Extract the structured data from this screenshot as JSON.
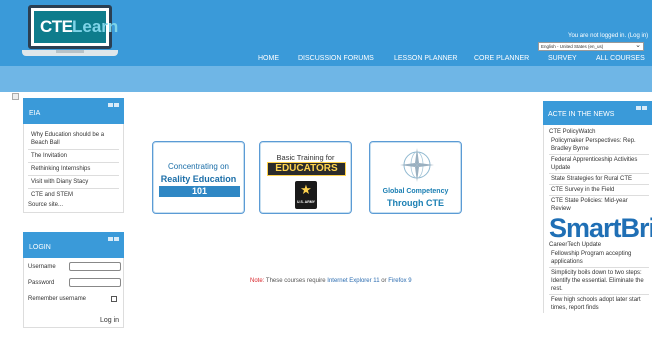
{
  "header": {
    "logo_text_a": "CTE",
    "logo_text_b": "Learn",
    "login_status": "You are not logged in. (Log in)",
    "language": "English - United States (en_us)"
  },
  "nav": {
    "items": [
      "HOME",
      "DISCUSSION FORUMS",
      "LESSON PLANNER",
      "CORE PLANNER",
      "SURVEY",
      "ALL COURSES"
    ]
  },
  "eia_block": {
    "title": "EIA",
    "links": [
      "Why Education should be a Beach Ball",
      "The Invitation",
      "Rethinking Internships",
      "Visit with Diany Stacy",
      "CTE and STEM"
    ],
    "more": "Source site..."
  },
  "login_block": {
    "title": "LOGIN",
    "username_label": "Username",
    "password_label": "Password",
    "remember_label": "Remember username",
    "button_label": "Log in"
  },
  "courses": {
    "c1": {
      "line1": "Concentrating on",
      "line2": "Reality Education",
      "line3": "101"
    },
    "c2": {
      "line1": "Basic Training for",
      "line2": "EDUCATORS",
      "army": "U.S. ARMY"
    },
    "c3": {
      "line1": "Global Competency",
      "line2": "Through CTE"
    }
  },
  "note": {
    "label": "Note:",
    "text": "These courses require",
    "ie": "Internet Explorer 11",
    "or": "or",
    "ff": "Firefox 9"
  },
  "acte_block": {
    "title": "ACTE IN THE NEWS",
    "section1": "CTE PolicyWatch",
    "items1": [
      "Policymaker Perspectives: Rep. Bradley Byrne",
      "Federal Apprenticeship Activities Update",
      "State Strategies for Rural CTE",
      "CTE Survey in the Field",
      "CTE State Policies: Mid-year Review"
    ],
    "smartbrief": "SmartBrief",
    "section2": "CareerTech Update",
    "items2": [
      "Fellowship Program accepting applications",
      "Simplicity boils down to two steps: Identify the essential. Eliminate the rest.",
      "Few high schools adopt later start times, report finds"
    ]
  },
  "colors": {
    "header": "#3a9ad9",
    "subbar": "#6fb6e6",
    "accent": "#1f6fb5",
    "note_red": "#d9262b"
  }
}
